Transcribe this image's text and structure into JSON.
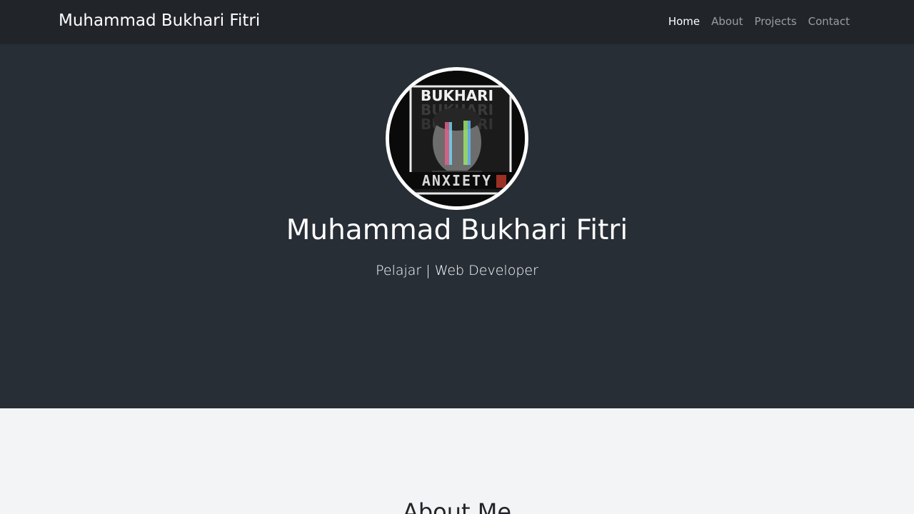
{
  "navbar": {
    "brand": "Muhammad Bukhari Fitri",
    "links": [
      {
        "label": "Home",
        "active": true
      },
      {
        "label": "About",
        "active": false
      },
      {
        "label": "Projects",
        "active": false
      },
      {
        "label": "Contact",
        "active": false
      }
    ]
  },
  "hero": {
    "avatar_text_top": "BUKHARI",
    "avatar_text_bottom": "ANXIETY",
    "name": "Muhammad Bukhari Fitri",
    "subtitle": "Pelajar | Web Developer"
  },
  "about": {
    "title": "About Me"
  },
  "colors": {
    "navbar_bg": "#212529",
    "hero_bg": "#272e36",
    "page_bg": "#f2f4f5"
  }
}
